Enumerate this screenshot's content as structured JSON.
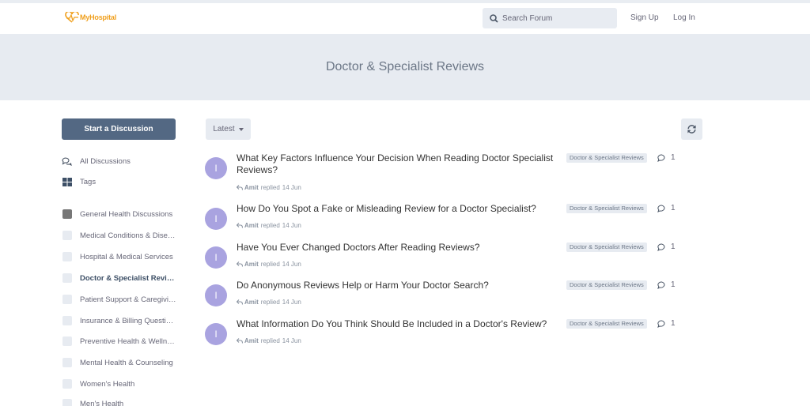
{
  "header": {
    "logo_text": "MyHospital",
    "search_placeholder": "Search Forum",
    "signup_label": "Sign Up",
    "login_label": "Log In",
    "brand_color": "#f0a01e"
  },
  "hero": {
    "title": "Doctor & Specialist Reviews"
  },
  "sidebar": {
    "start_button": "Start a Discussion",
    "nav": [
      {
        "label": "All Discussions",
        "icon": "comments-icon"
      },
      {
        "label": "Tags",
        "icon": "tags-grid-icon"
      }
    ],
    "tags": [
      {
        "label": "General Health Discussions"
      },
      {
        "label": "Medical Conditions & Diseases"
      },
      {
        "label": "Hospital & Medical Services"
      },
      {
        "label": "Doctor & Specialist Reviews",
        "active": true
      },
      {
        "label": "Patient Support & Caregiving"
      },
      {
        "label": "Insurance & Billing Questions"
      },
      {
        "label": "Preventive Health & Wellness"
      },
      {
        "label": "Mental Health & Counseling"
      },
      {
        "label": "Women's Health"
      },
      {
        "label": "Men's Health"
      }
    ]
  },
  "toolbar": {
    "sort_label": "Latest"
  },
  "discussions": [
    {
      "avatar": "I",
      "title": "What Key Factors Influence Your Decision When Reading Doctor Specialist Reviews?",
      "author": "Amit",
      "action": "replied",
      "date": "14 Jun",
      "tag": "Doctor & Specialist Reviews",
      "replies": "1"
    },
    {
      "avatar": "I",
      "title": "How Do You Spot a Fake or Misleading Review for a Doctor Specialist?",
      "author": "Amit",
      "action": "replied",
      "date": "14 Jun",
      "tag": "Doctor & Specialist Reviews",
      "replies": "1"
    },
    {
      "avatar": "I",
      "title": "Have You Ever Changed Doctors After Reading Reviews?",
      "author": "Amit",
      "action": "replied",
      "date": "14 Jun",
      "tag": "Doctor & Specialist Reviews",
      "replies": "1"
    },
    {
      "avatar": "I",
      "title": "Do Anonymous Reviews Help or Harm Your Doctor Search?",
      "author": "Amit",
      "action": "replied",
      "date": "14 Jun",
      "tag": "Doctor & Specialist Reviews",
      "replies": "1"
    },
    {
      "avatar": "I",
      "title": "What Information Do You Think Should Be Included in a Doctor's Review?",
      "author": "Amit",
      "action": "replied",
      "date": "14 Jun",
      "tag": "Doctor & Specialist Reviews",
      "replies": "1"
    }
  ]
}
